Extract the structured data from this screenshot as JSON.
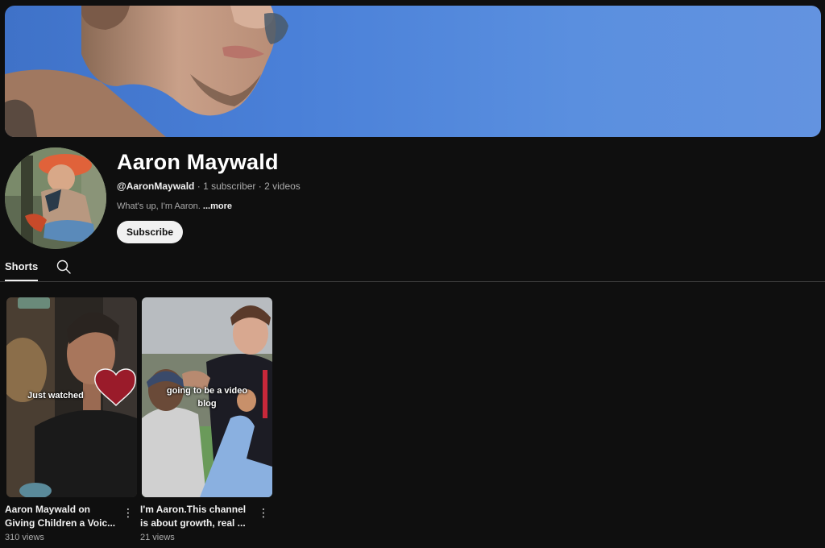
{
  "channel": {
    "name": "Aaron Maywald",
    "handle": "@AaronMaywald",
    "meta_sep_1": " · ",
    "subscribers": "1 subscriber",
    "meta_sep_2": " · ",
    "videos": "2 videos",
    "description": "What's up, I'm Aaron.",
    "more_label": "...more",
    "subscribe_label": "Subscribe"
  },
  "tabs": {
    "shorts_label": "Shorts",
    "search_icon": "search-icon"
  },
  "shorts": [
    {
      "caption": "Just watched",
      "title_line1": "Aaron Maywald on",
      "title_line2": "Giving Children a Voic...",
      "views": "310 views"
    },
    {
      "caption_line1": "going to be a video",
      "caption_line2": "blog",
      "title_line1": "I'm Aaron.This channel",
      "title_line2": "is about growth, real ...",
      "views": "21 views"
    }
  ],
  "colors": {
    "background": "#0f0f0f",
    "banner_sky": "#4a80d8",
    "text_primary": "#f1f1f1",
    "text_secondary": "#aaaaaa",
    "subscribe_bg": "#f1f1f1",
    "heart": "#9a1b2a"
  }
}
